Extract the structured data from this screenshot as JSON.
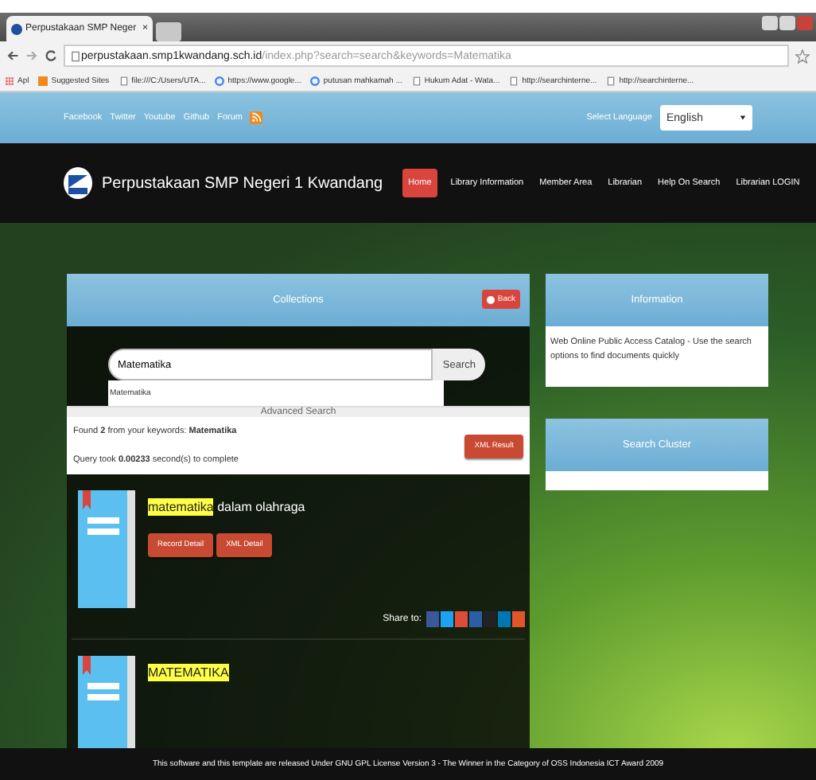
{
  "browser": {
    "tab": {
      "title": "Perpustakaan SMP Neger",
      "close": "×"
    },
    "url": {
      "host": "perpustakaan.smp1kwandang.sch.id",
      "path": "/index.php?search=search&keywords=Matematika"
    },
    "bookmarks": [
      {
        "kind": "apps",
        "label": "Apl"
      },
      {
        "kind": "star",
        "label": "Suggested Sites"
      },
      {
        "kind": "page",
        "label": "file:///C:/Users/UTA..."
      },
      {
        "kind": "google",
        "label": "https://www.google..."
      },
      {
        "kind": "google",
        "label": "putusan mahkamah ..."
      },
      {
        "kind": "page",
        "label": "Hukum Adat - Wata..."
      },
      {
        "kind": "page",
        "label": "http://searchinterne..."
      },
      {
        "kind": "page",
        "label": "http://searchinterne..."
      }
    ]
  },
  "topbar": {
    "links": [
      "Facebook",
      "Twitter",
      "Youtube",
      "Github",
      "Forum"
    ],
    "language_label": "Select Language",
    "language": "English"
  },
  "header": {
    "site_title": "Perpustakaan SMP Negeri 1 Kwandang",
    "nav": [
      {
        "label": "Home",
        "selected": true
      },
      {
        "label": "Library Information",
        "selected": false
      },
      {
        "label": "Member Area",
        "selected": false
      },
      {
        "label": "Librarian",
        "selected": false
      },
      {
        "label": "Help On Search",
        "selected": false
      },
      {
        "label": "Librarian LOGIN",
        "selected": false
      }
    ]
  },
  "collections": {
    "title": "Collections",
    "back": "Back",
    "search_value": "Matematika",
    "search_button": "Search",
    "suggestion": "Matematika",
    "advanced": "Advanced Search",
    "found": "Found **2** from your keywords: **Matematika**",
    "query": "Query took **0.00233** second(s) to complete",
    "xml_result": "XML Result",
    "results": [
      {
        "highlight": "matematika",
        "rest": " dalam olahraga",
        "buttons": [
          "Record Detail",
          "XML Detail"
        ],
        "share": "Share to:"
      },
      {
        "highlight": "MATEMATIKA"
      }
    ]
  },
  "information": {
    "title": "Information",
    "text": "Web Online Public Access Catalog - Use the search options to find documents quickly"
  },
  "search_cluster": {
    "title": "Search Cluster"
  },
  "footer": "This software and this template are released Under GNU GPL License Version 3 - The Winner in the Category of OSS Indonesia ICT Award 2009"
}
